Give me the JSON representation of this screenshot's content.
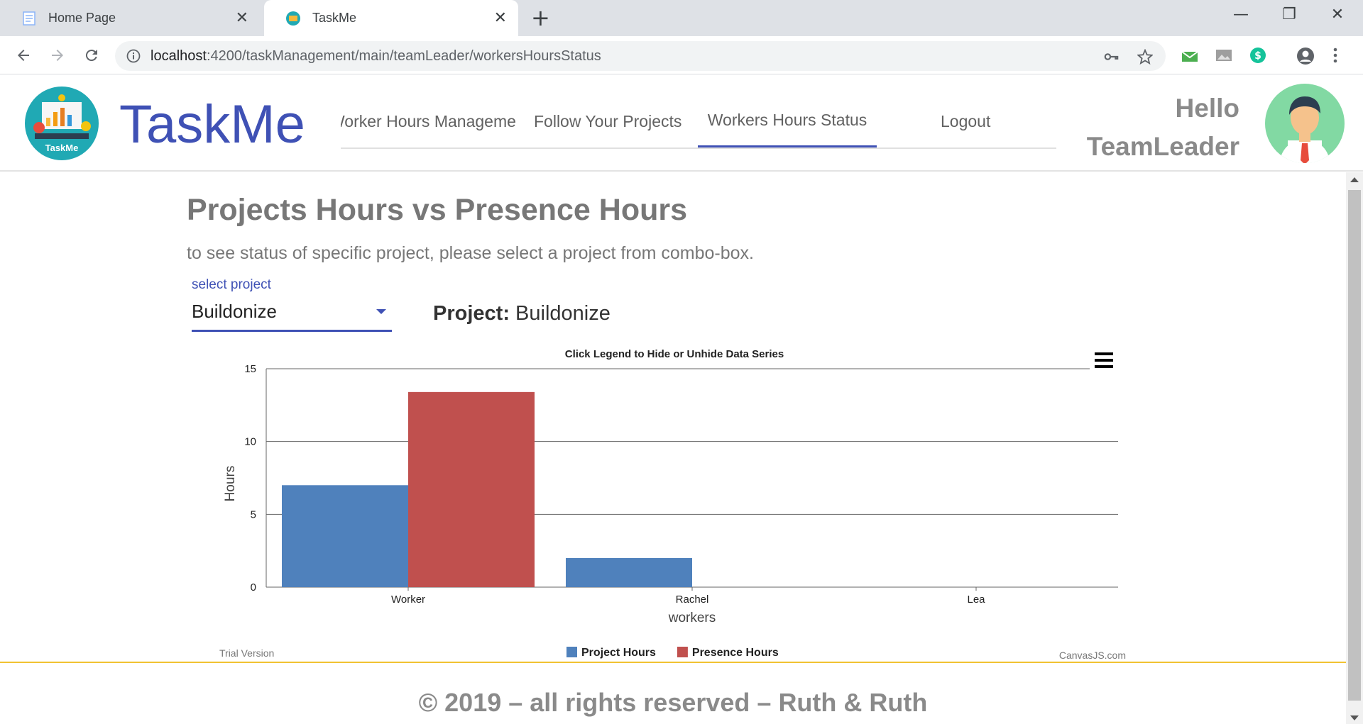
{
  "browser": {
    "tabs": [
      {
        "title": "Home Page",
        "icon": "document-icon"
      },
      {
        "title": "TaskMe",
        "icon": "globe-favicon-icon"
      }
    ],
    "url_host": "localhost",
    "url_path": ":4200/taskManagement/main/teamLeader/workersHoursStatus"
  },
  "header": {
    "logo_caption": "TaskMe",
    "brand": "TaskMe",
    "nav": [
      {
        "label": "Worker Hours Manageme"
      },
      {
        "label": "Follow Your Projects"
      },
      {
        "label": "Workers Hours Status"
      },
      {
        "label": "Logout"
      }
    ],
    "active_nav": "Workers Hours Status",
    "greeting_line1": "Hello",
    "greeting_line2": "TeamLeader"
  },
  "main": {
    "title": "Projects Hours vs Presence Hours",
    "subtitle": "to see status of specific project, please select a project from combo-box.",
    "select_label": "select project",
    "select_value": "Buildonize",
    "project_label": "Project:",
    "project_value": "Buildonize"
  },
  "chart_data": {
    "type": "bar",
    "title": "Click Legend to Hide or Unhide Data Series",
    "xlabel": "workers",
    "ylabel": "Hours",
    "categories": [
      "Worker",
      "Rachel",
      "Lea"
    ],
    "series": [
      {
        "name": "Project Hours",
        "color": "#4f81bc",
        "values": [
          7,
          2,
          0
        ]
      },
      {
        "name": "Presence Hours",
        "color": "#c0504e",
        "values": [
          13.4,
          0,
          0
        ]
      }
    ],
    "ylim": [
      0,
      15
    ],
    "yticks": [
      0,
      5,
      10,
      15
    ],
    "grid": true,
    "legend": "bottom",
    "watermark_left": "Trial Version",
    "watermark_right": "CanvasJS.com"
  },
  "footer": {
    "text": "© 2019 – all rights reserved – Ruth & Ruth"
  },
  "colors": {
    "accent": "#3f51b5",
    "footer_line": "#f1c232"
  }
}
